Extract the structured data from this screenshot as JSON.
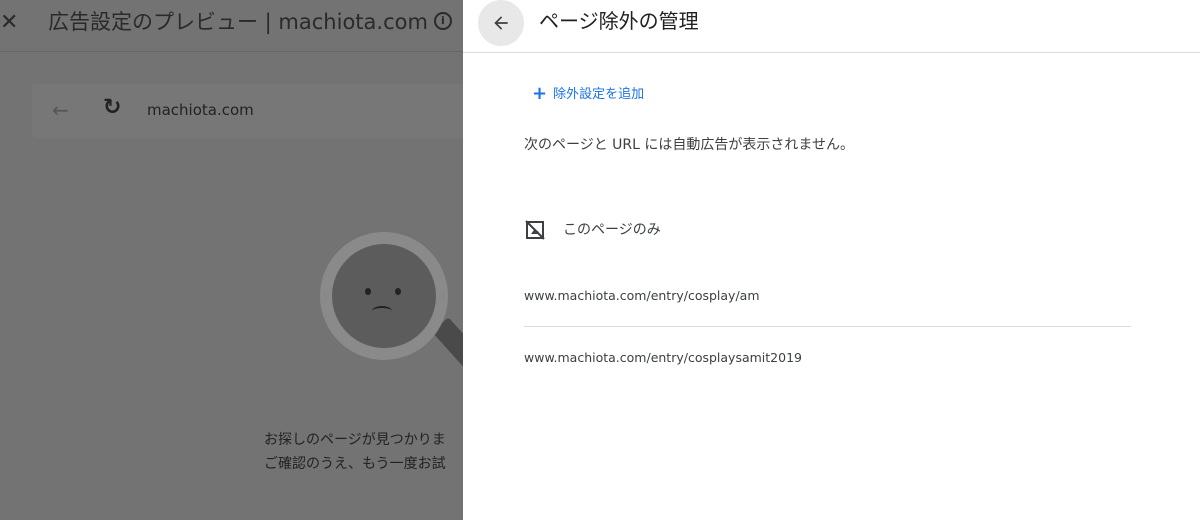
{
  "background": {
    "title": "広告設定のプレビュー | machiota.com",
    "close_icon": "close-icon",
    "info_icon": "info-icon",
    "browser_url": "machiota.com",
    "message_line1": "お探しのページが見つかりま",
    "message_line2": "ご確認のうえ、もう一度お試"
  },
  "panel": {
    "title": "ページ除外の管理",
    "back_icon": "arrow-back-icon",
    "add_label": "除外設定を追加",
    "description": "次のページと URL には自動広告が表示されません。",
    "section_label": "このページのみ",
    "section_icon": "page-off-icon",
    "urls": [
      "www.machiota.com/entry/cosplay/am",
      "www.machiota.com/entry/cosplaysamit2019"
    ],
    "accent_color": "#1a73e8"
  }
}
